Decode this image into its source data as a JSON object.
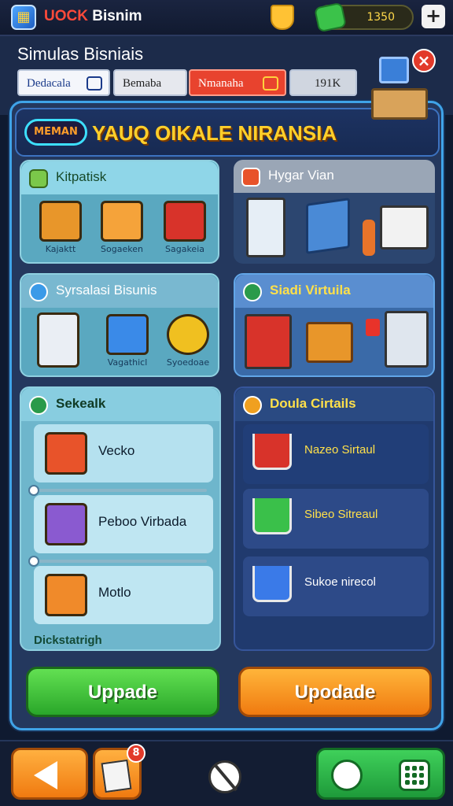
{
  "topbar": {
    "logo_glyph": "▦",
    "title_prefix": "UOCK",
    "title_suffix": " Bisnim",
    "coins": "1350"
  },
  "header": {
    "title": "Simulas Bisniais",
    "tabs": [
      {
        "label": "Dedacala",
        "active": false
      },
      {
        "label": "Bemaba",
        "active": false
      },
      {
        "label": "Nmanaha",
        "active": true
      },
      {
        "label": "191K",
        "active": false
      }
    ]
  },
  "banner": {
    "badge": "MEMAN",
    "title": "YAUQ OIKALE NIRANSIA"
  },
  "cards": {
    "kitpatisk": {
      "title": "Kitpatisk",
      "items": [
        "Kajaktt",
        "Sogaeken",
        "Sagakeia"
      ]
    },
    "hygar": {
      "title": "Hygar Vian"
    },
    "sysralasi": {
      "title": "Syrsalasi Bisunis",
      "items": [
        "Vagathicl",
        "Syoedoae"
      ]
    },
    "siadi": {
      "title": "Siadi Virtuila"
    },
    "sekealk": {
      "title": "Sekealk",
      "rows": [
        "Vecko",
        "Peboo Virbada",
        "Motlo"
      ],
      "footer": "Dickstatrigh"
    },
    "doula": {
      "title": "Doula Cirtails",
      "rows": [
        "Nazeo Sirtaul",
        "Sibeo Sitreaul",
        "Sukoe nirecol"
      ]
    }
  },
  "buttons": {
    "left": "Uppade",
    "right": "Upodade"
  },
  "bottom": {
    "doc_badge": "8"
  },
  "colors": {
    "accent_blue": "#3fa3e8",
    "yellow": "#ffcf2a",
    "green": "#2aa72a",
    "orange": "#f07a10",
    "red": "#e23a2a"
  }
}
